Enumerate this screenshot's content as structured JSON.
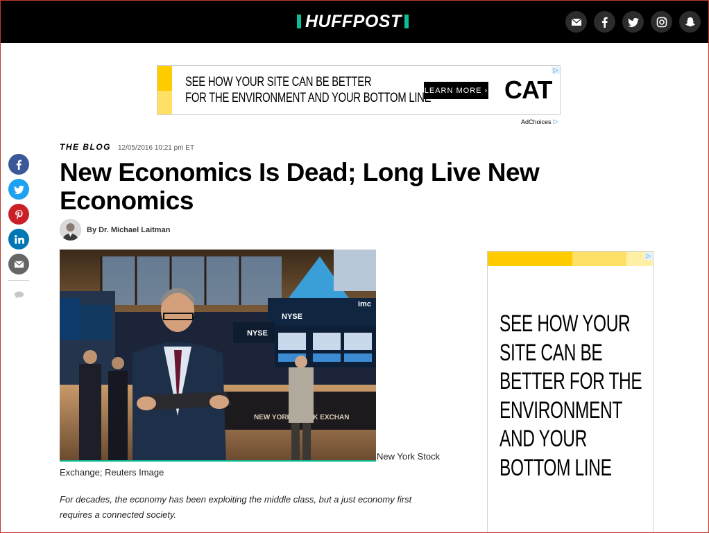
{
  "header": {
    "logo_text": "HUFFPOST",
    "social": [
      "mail-icon",
      "facebook-icon",
      "twitter-icon",
      "instagram-icon",
      "snapchat-icon"
    ],
    "colors": {
      "background": "#000000",
      "accent": "#0dbe98"
    }
  },
  "top_ad": {
    "line1": "SEE HOW YOUR SITE CAN BE BETTER",
    "line2": "FOR THE ENVIRONMENT AND YOUR BOTTOM LINE",
    "cta": "LEARN MORE ›",
    "brand": "CAT",
    "adchoices": "AdChoices"
  },
  "share_rail": [
    {
      "name": "facebook",
      "color": "#3b5998"
    },
    {
      "name": "twitter",
      "color": "#1da1f2"
    },
    {
      "name": "pinterest",
      "color": "#cb2027"
    },
    {
      "name": "linkedin",
      "color": "#0077b5"
    },
    {
      "name": "email",
      "color": "#666666"
    }
  ],
  "article": {
    "kicker": "THE BLOG",
    "date": "12/05/2016 10:21 pm ET",
    "headline": "New Economics Is Dead; Long Live New Economics",
    "byline": "By Dr. Michael Laitman",
    "caption_part1": "New York Stock",
    "caption_part2": "Exchange; Reuters Image",
    "lede_line1": "For decades, the economy has been exploiting the middle class, but a just economy first",
    "lede_line2": "requires a connected society."
  },
  "photo": {
    "signs": [
      "NYSE",
      "imc",
      "NYSE",
      "NEW YORK STOCK EXCHAN"
    ]
  },
  "side_ad": {
    "lines": [
      "SEE HOW YOUR",
      "SITE CAN BE",
      "BETTER FOR THE",
      "ENVIRONMENT",
      "AND YOUR",
      "BOTTOM LINE"
    ]
  }
}
